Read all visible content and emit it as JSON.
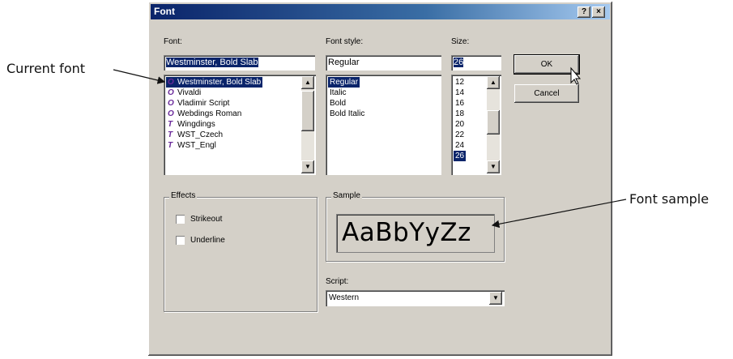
{
  "annotations": {
    "current_font": "Current font",
    "font_sample": "Font sample"
  },
  "dialog": {
    "title": "Font",
    "help_btn": "?",
    "close_btn": "×"
  },
  "font": {
    "label": "Font:",
    "value": "Westminster, Bold Slab",
    "items": [
      {
        "label": "Westminster, Bold Slab",
        "icon": "O",
        "selected": true
      },
      {
        "label": "Vivaldi",
        "icon": "O"
      },
      {
        "label": "Vladimir Script",
        "icon": "O"
      },
      {
        "label": "Webdings Roman",
        "icon": "O"
      },
      {
        "label": "Wingdings",
        "icon": "T"
      },
      {
        "label": "WST_Czech",
        "icon": "T"
      },
      {
        "label": "WST_Engl",
        "icon": "T"
      }
    ]
  },
  "style": {
    "label": "Font style:",
    "value": "Regular",
    "items": [
      {
        "label": "Regular",
        "selected": true
      },
      {
        "label": "Italic"
      },
      {
        "label": "Bold"
      },
      {
        "label": "Bold Italic"
      }
    ]
  },
  "size": {
    "label": "Size:",
    "value": "26",
    "items": [
      {
        "label": "12"
      },
      {
        "label": "14"
      },
      {
        "label": "16"
      },
      {
        "label": "18"
      },
      {
        "label": "20"
      },
      {
        "label": "22"
      },
      {
        "label": "24"
      },
      {
        "label": "26",
        "selected": true
      }
    ]
  },
  "buttons": {
    "ok": "OK",
    "cancel": "Cancel"
  },
  "effects": {
    "label": "Effects",
    "strikeout": "Strikeout",
    "underline": "Underline"
  },
  "sample": {
    "label": "Sample",
    "text": "AaBbYyZz"
  },
  "script": {
    "label": "Script:",
    "value": "Western"
  },
  "colors": {
    "dialog_face": "#d4d0c8",
    "title_start": "#0a246a",
    "highlight": "#0a246a"
  }
}
